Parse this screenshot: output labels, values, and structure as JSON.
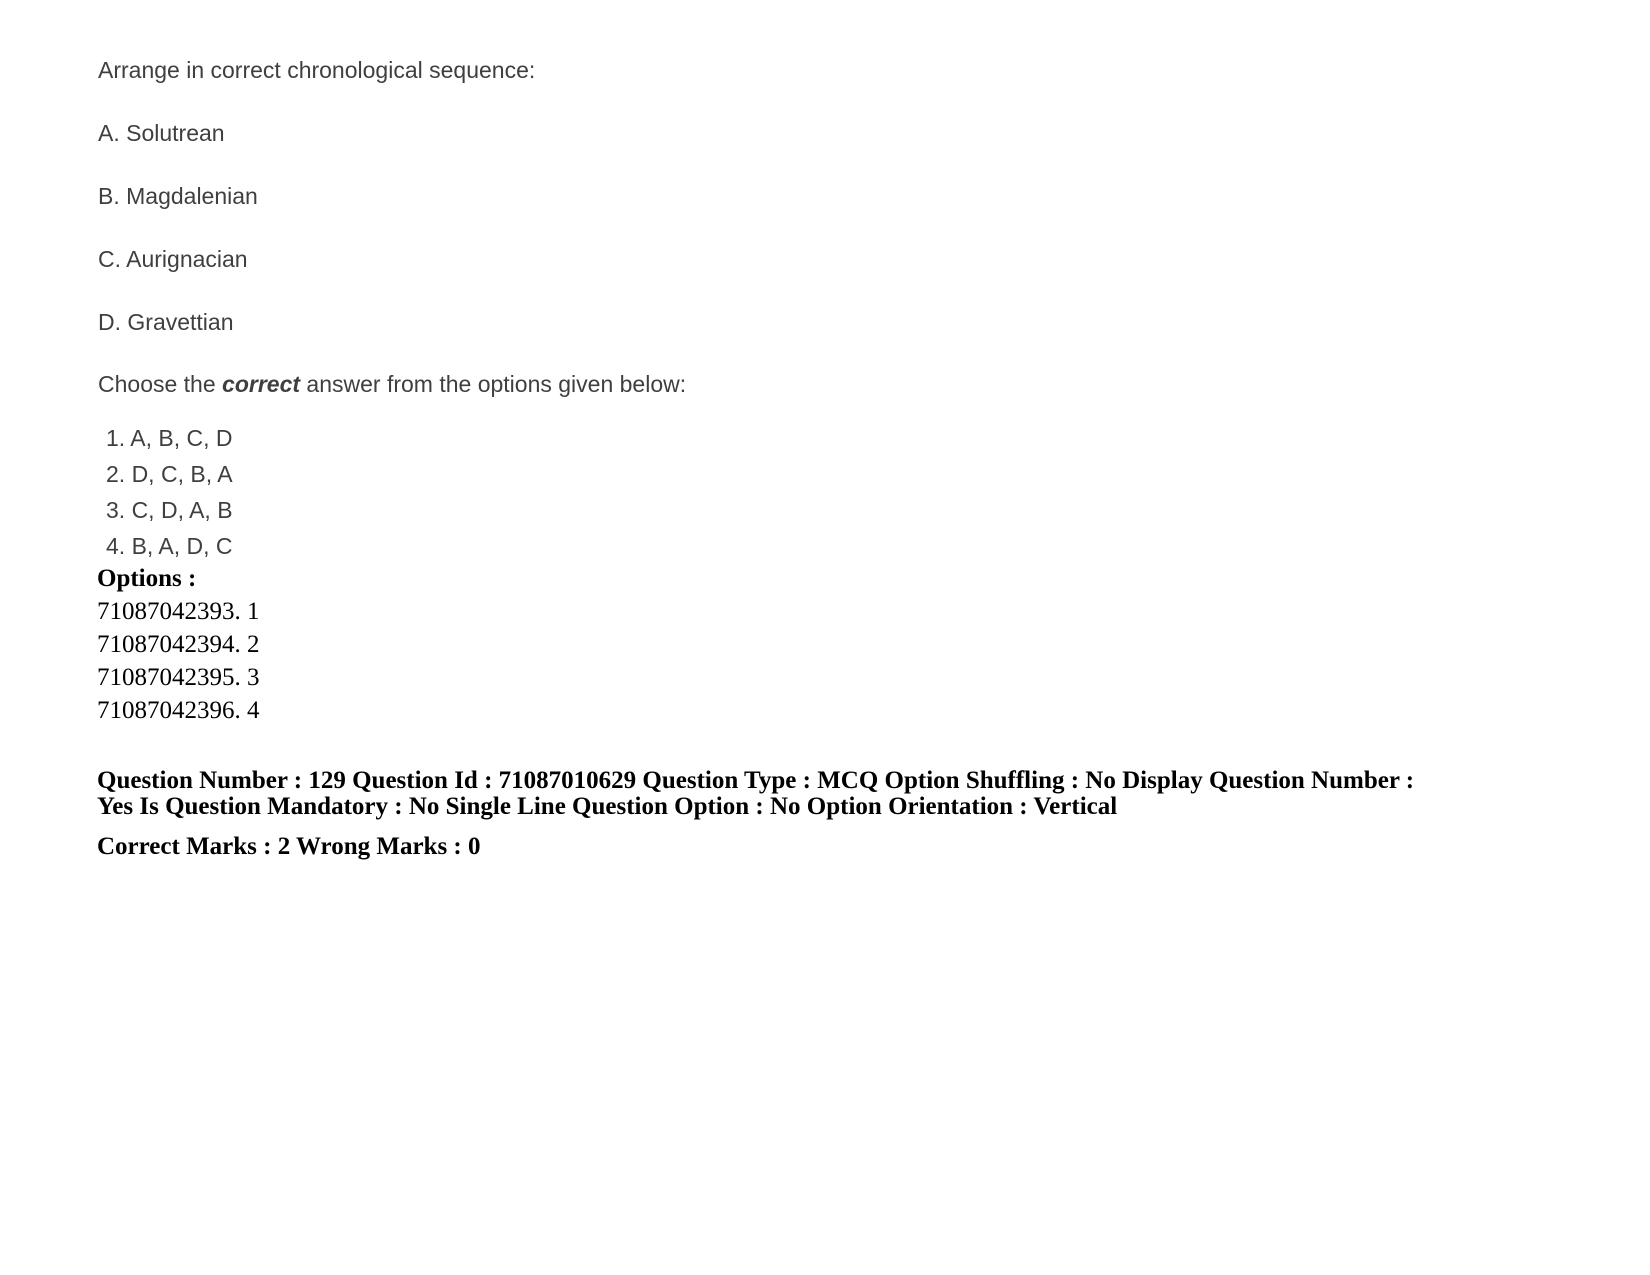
{
  "question": {
    "stem": "Arrange in correct chronological sequence:",
    "sequence_items": [
      "A. Solutrean",
      "B. Magdalenian",
      "C. Aurignacian",
      "D. Gravettian"
    ],
    "choose_prefix": "Choose the ",
    "choose_emphasis": "correct",
    "choose_suffix": " answer from the options given below:",
    "answers": [
      "1. A, B, C, D",
      "2. D, C, B, A",
      "3. C, D, A, B",
      "4. B, A, D, C"
    ]
  },
  "options_block": {
    "title": "Options :",
    "items": [
      "71087042393. 1",
      "71087042394. 2",
      "71087042395. 3",
      "71087042396. 4"
    ]
  },
  "metadata": {
    "line1": "Question Number : 129 Question Id : 71087010629 Question Type : MCQ Option Shuffling : No Display Question Number : Yes Is Question Mandatory : No Single Line Question Option : No Option Orientation : Vertical",
    "line2": "Correct Marks : 2 Wrong Marks : 0"
  },
  "colors": {
    "page_background": "#ffffff",
    "question_text": "#3f3f3f",
    "metadata_text": "#000000"
  }
}
